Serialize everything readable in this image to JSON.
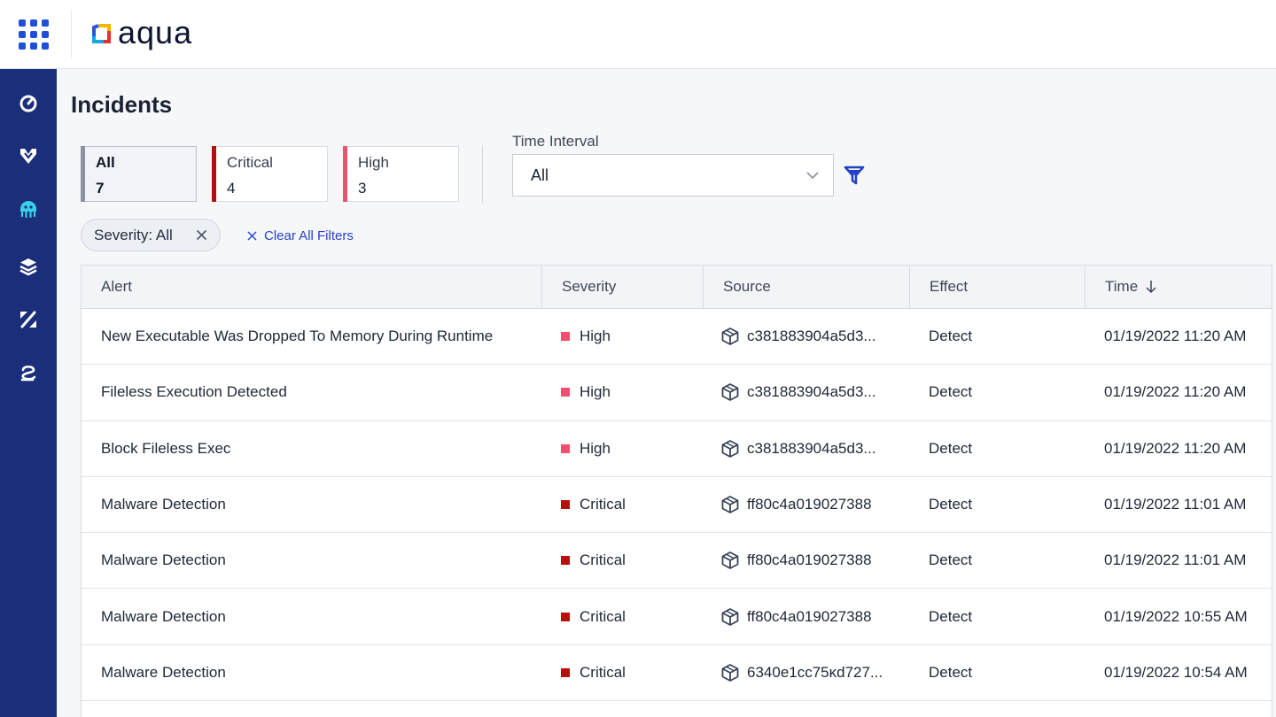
{
  "brand": {
    "name": "aqua"
  },
  "colors": {
    "sidebar": "#1b2e7a",
    "accent": "#2442c7",
    "critical": "#b3110d",
    "high": "#f0506e",
    "all": "#8b93a3"
  },
  "nav": {
    "items": [
      {
        "icon": "dashboard-gauge-icon"
      },
      {
        "icon": "shield-chevron-icon"
      },
      {
        "icon": "incidents-jellyfish-icon",
        "active": true
      },
      {
        "icon": "layers-stack-icon"
      },
      {
        "icon": "policy-percent-icon"
      },
      {
        "icon": "integrations-link-icon"
      }
    ]
  },
  "page": {
    "title": "Incidents"
  },
  "severity_cards": [
    {
      "label": "All",
      "count": "7",
      "active": true
    },
    {
      "label": "Critical",
      "count": "4"
    },
    {
      "label": "High",
      "count": "3"
    }
  ],
  "time_interval": {
    "label": "Time Interval",
    "value": "All"
  },
  "active_filters": {
    "chips": [
      {
        "label": "Severity: All"
      }
    ],
    "clear_all": "Clear All Filters"
  },
  "table": {
    "columns": [
      "Alert",
      "Severity",
      "Source",
      "Effect",
      "Time"
    ],
    "sort": {
      "column": "Time",
      "direction": "desc"
    },
    "rows": [
      {
        "alert": "New Executable Was Dropped To Memory During Runtime",
        "severity": "High",
        "source": "c381883904a5d3...",
        "effect": "Detect",
        "time": "01/19/2022 11:20 AM"
      },
      {
        "alert": "Fileless Execution Detected",
        "severity": "High",
        "source": "c381883904a5d3...",
        "effect": "Detect",
        "time": "01/19/2022 11:20 AM"
      },
      {
        "alert": "Block Fileless Exec",
        "severity": "High",
        "source": "c381883904a5d3...",
        "effect": "Detect",
        "time": "01/19/2022 11:20 AM"
      },
      {
        "alert": "Malware Detection",
        "severity": "Critical",
        "source": "ff80c4a019027388",
        "effect": "Detect",
        "time": "01/19/2022 11:01 AM"
      },
      {
        "alert": "Malware Detection",
        "severity": "Critical",
        "source": "ff80c4a019027388",
        "effect": "Detect",
        "time": "01/19/2022 11:01 AM"
      },
      {
        "alert": "Malware Detection",
        "severity": "Critical",
        "source": "ff80c4a019027388",
        "effect": "Detect",
        "time": "01/19/2022 10:55 AM"
      },
      {
        "alert": "Malware Detection",
        "severity": "Critical",
        "source": "6340e1cc75ĸd727...",
        "effect": "Detect",
        "time": "01/19/2022 10:54 AM"
      }
    ]
  }
}
